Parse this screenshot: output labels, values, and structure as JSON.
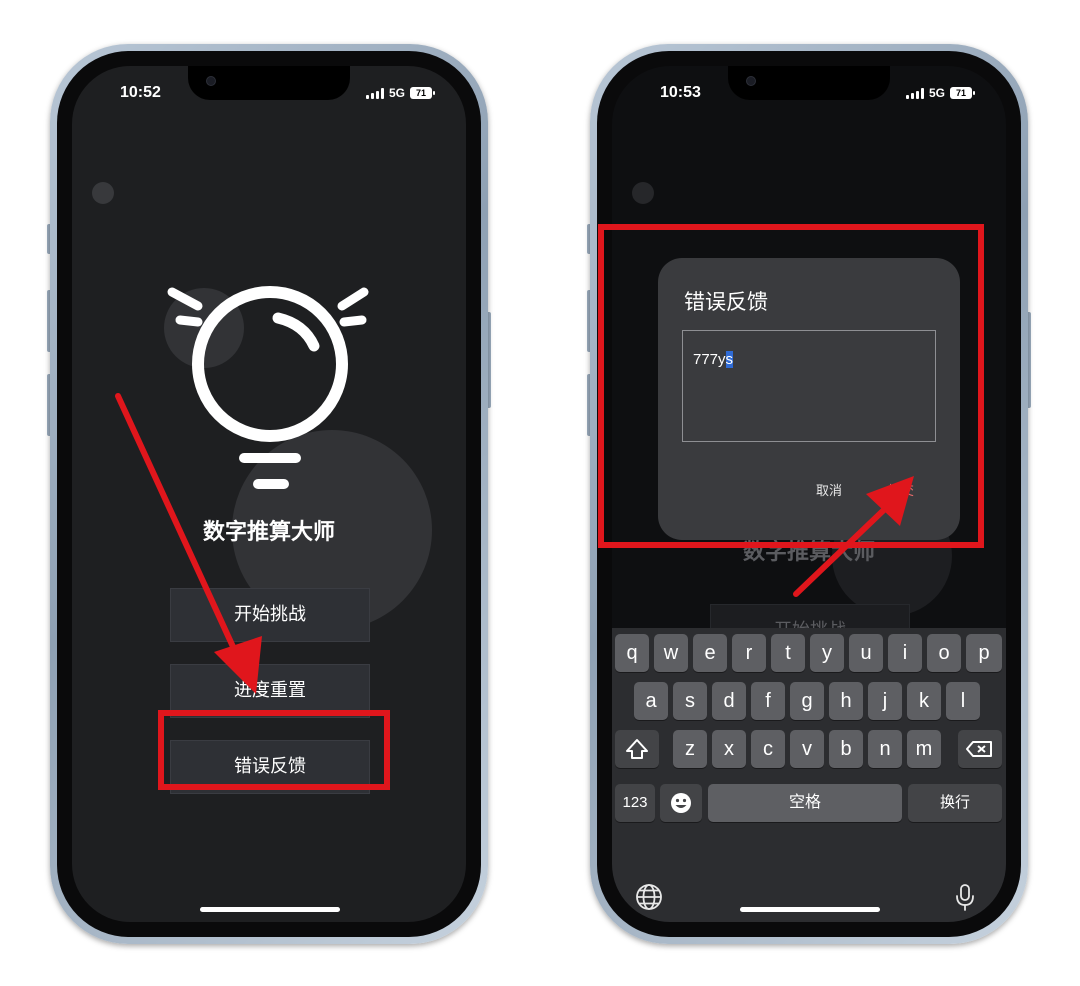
{
  "left_phone": {
    "time": "10:52",
    "network": "5G",
    "battery": "71",
    "app_title": "数字推算大师",
    "buttons": [
      {
        "label": "开始挑战"
      },
      {
        "label": "进度重置"
      },
      {
        "label": "错误反馈"
      }
    ]
  },
  "right_phone": {
    "time": "10:53",
    "network": "5G",
    "battery": "71",
    "app_title": "数字推算大师",
    "partial_button_label": "开始挑战",
    "dialog": {
      "title": "错误反馈",
      "input_value_prefix": "777y",
      "input_value_selected": "s",
      "cancel_label": "取消",
      "submit_label": "提交"
    },
    "keyboard": {
      "row1": [
        "q",
        "w",
        "e",
        "r",
        "t",
        "y",
        "u",
        "i",
        "o",
        "p"
      ],
      "row2": [
        "a",
        "s",
        "d",
        "f",
        "g",
        "h",
        "j",
        "k",
        "l"
      ],
      "row3": [
        "z",
        "x",
        "c",
        "v",
        "b",
        "n",
        "m"
      ],
      "numbers_key": "123",
      "space_label": "空格",
      "return_label": "换行",
      "shift_icon": "shift-icon",
      "backspace_icon": "backspace-icon",
      "emoji_icon": "emoji-icon",
      "globe_icon": "globe-icon",
      "mic_icon": "microphone-icon"
    }
  },
  "colors": {
    "annotation_red": "#e0161c",
    "submit_text": "#e46a6a",
    "screen_bg": "#1e1f21",
    "button_bg": "#2e3035"
  }
}
